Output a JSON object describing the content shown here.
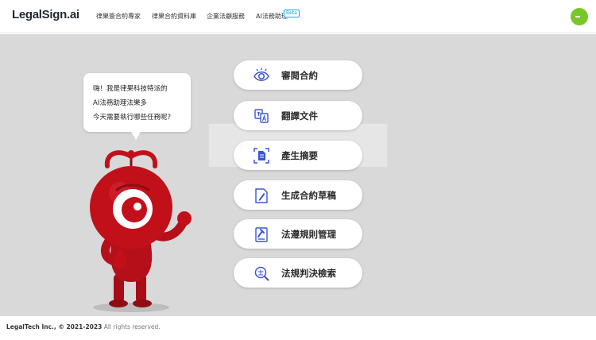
{
  "header": {
    "logo_text": "LegalSign.ai",
    "nav": [
      {
        "label": "律果簽合約專家"
      },
      {
        "label": "律果合約資料庫"
      },
      {
        "label": "企業法顧服務"
      },
      {
        "label": "AI法務助理"
      }
    ],
    "beta_badge": "Beta"
  },
  "assistant": {
    "greeting_lines": [
      "嗨！我是律果科技特派的",
      "AI法務助理法樂多",
      "今天需要執行哪些任務呢？"
    ]
  },
  "actions": [
    {
      "label": "審閱合約",
      "icon": "eye-icon"
    },
    {
      "label": "翻譯文件",
      "icon": "translate-icon"
    },
    {
      "label": "產生摘要",
      "icon": "summary-icon"
    },
    {
      "label": "生成合約草稿",
      "icon": "draft-pen-icon"
    },
    {
      "label": "法遵規則管理",
      "icon": "compliance-icon"
    },
    {
      "label": "法規判決檢索",
      "icon": "search-law-icon"
    }
  ],
  "footer": {
    "company": "LegalTech Inc., © 2021-2023",
    "rights": "All rights reserved."
  },
  "colors": {
    "accent_blue": "#3b56d6",
    "mascot_red": "#c2101b",
    "avatar_green": "#78c728",
    "beta_blue": "#16a7d9",
    "background_gray": "#d9d9d9"
  }
}
